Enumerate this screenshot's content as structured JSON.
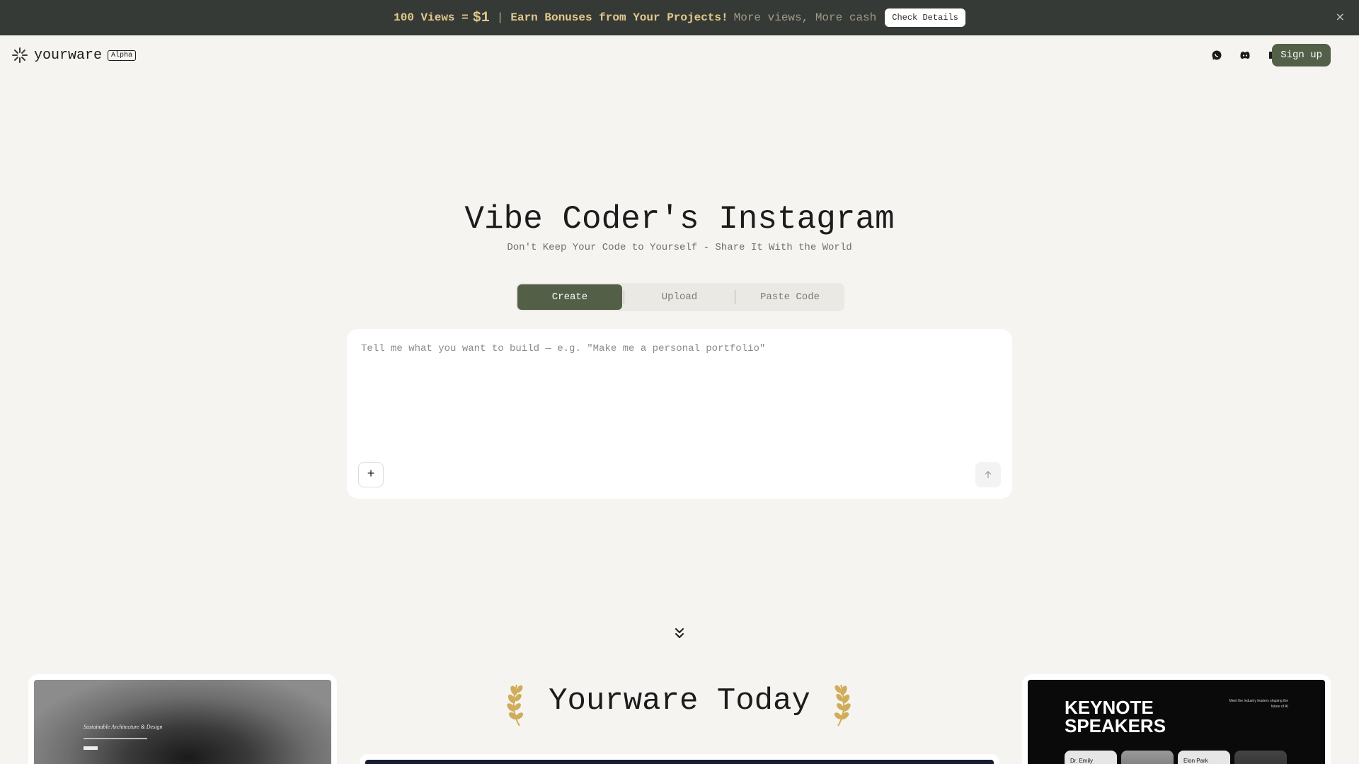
{
  "banner": {
    "views_prefix": "100 Views =",
    "dollar": "$1",
    "separator": "|",
    "headline": "Earn Bonuses from Your Projects!",
    "subtext": "More views, More cash",
    "check_label": "Check Details",
    "close": "×"
  },
  "header": {
    "brand": "yourware",
    "badge": "Alpha",
    "icons": [
      "whatsapp-icon",
      "discord-icon",
      "book-icon"
    ],
    "signup_label": "Sign up"
  },
  "hero": {
    "title": "Vibe Coder's Instagram",
    "subtitle": "Don't Keep Your Code to Yourself - Share It With the World"
  },
  "tabs": [
    {
      "label": "Create",
      "active": true
    },
    {
      "label": "Upload",
      "active": false
    },
    {
      "label": "Paste Code",
      "active": false
    }
  ],
  "prompt": {
    "placeholder": "Tell me what you want to build — e.g. \"Make me a personal portfolio\"",
    "plus": "+"
  },
  "today": {
    "title": "Yourware Today"
  },
  "cards": {
    "left": {
      "heading": "Sustainable Architecture & Design"
    },
    "right": {
      "heading_line1": "KEYNOTE",
      "heading_line2": "SPEAKERS",
      "side_text": "Meet the industry leaders shaping the future of AI",
      "speakers": [
        "Dr. Emily",
        "",
        "Elon Park",
        ""
      ]
    }
  },
  "colors": {
    "accent": "#535f47",
    "banner_bg": "#363a36",
    "banner_highlight": "#e2c98c",
    "page_bg": "#f5f4f0",
    "laurel": "#d0ad5a"
  }
}
